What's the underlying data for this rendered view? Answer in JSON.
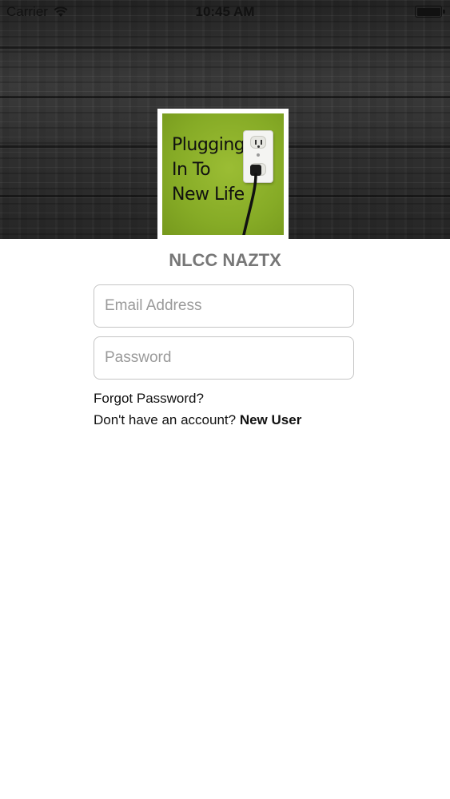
{
  "status_bar": {
    "carrier": "Carrier",
    "wifi_icon": "wifi-icon",
    "time": "10:45 AM",
    "battery_icon": "battery-icon"
  },
  "logo": {
    "line1": "Plugging",
    "line2": "In To",
    "line3": "New Life",
    "background_color": "#86ab26"
  },
  "app_title": "NLCC NAZTX",
  "login": {
    "email_placeholder": "Email Address",
    "email_value": "",
    "password_placeholder": "Password",
    "password_value": "",
    "forgot_label": "Forgot Password?",
    "signup_prompt": "Don't have an account?",
    "new_user_label": "New User"
  }
}
